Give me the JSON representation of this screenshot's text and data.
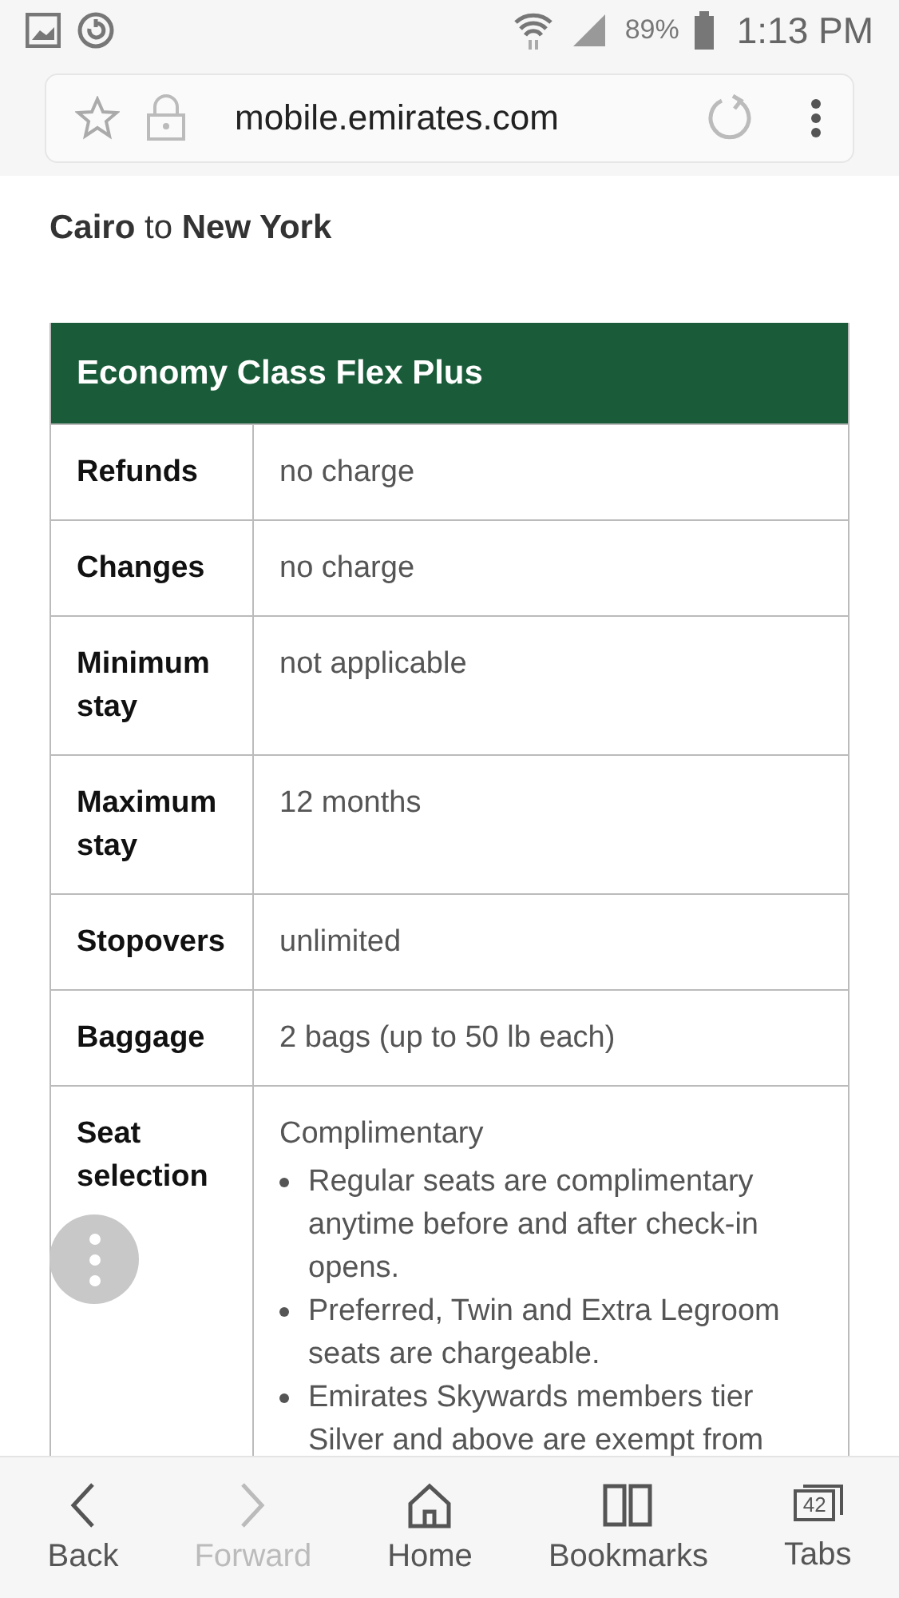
{
  "status_bar": {
    "battery": "89%",
    "time": "1:13 PM"
  },
  "address_bar": {
    "url": "mobile.emirates.com"
  },
  "route_title": "**Cairo** to **New York**",
  "fare_table": {
    "title": "Economy Class Flex Plus",
    "rows": [
      {
        "label": "Refunds",
        "value": "no charge"
      },
      {
        "label": "Changes",
        "value": "no charge"
      },
      {
        "label": "Minimum stay",
        "value": "not applicable"
      },
      {
        "label": "Maximum stay",
        "value": "12 months"
      },
      {
        "label": "Stopovers",
        "value": "unlimited"
      },
      {
        "label": "Baggage",
        "value": "2 bags (up to 50 lb each)"
      },
      {
        "label": "Seat selection",
        "value": "Complimentary",
        "bullets": [
          "Regular seats are complimentary anytime before and after check-in opens.",
          "Preferred, Twin and Extra Legroom seats are chargeable.",
          "Emirates Skywards members tier Silver and above are exempt from"
        ]
      }
    ]
  },
  "bottom_nav": [
    {
      "kind": "back",
      "label": "Back",
      "disabled": false
    },
    {
      "kind": "forward",
      "label": "Forward",
      "disabled": true
    },
    {
      "kind": "home",
      "label": "Home",
      "disabled": false
    },
    {
      "kind": "bookmarks",
      "label": "Bookmarks",
      "disabled": false
    },
    {
      "kind": "tabs",
      "label": "Tabs",
      "disabled": false,
      "count": "42"
    }
  ]
}
